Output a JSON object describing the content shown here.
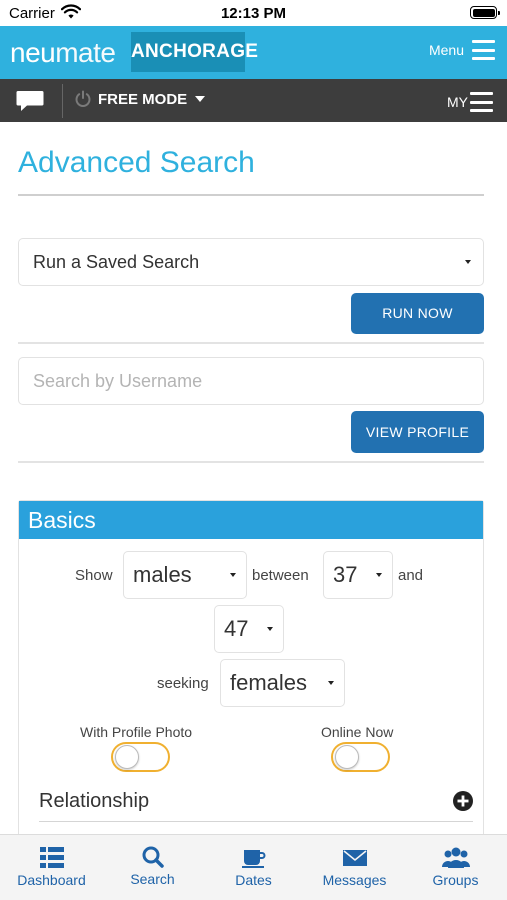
{
  "status_bar": {
    "carrier": "Carrier",
    "time": "12:13 PM"
  },
  "header": {
    "logo_left": "neu",
    "logo_right": "mate",
    "city": "ANCHORAGE",
    "menu_label": "Menu",
    "brand_color": "#2fb1de"
  },
  "subnav": {
    "mode_label": "FREE MODE",
    "my_label": "MY"
  },
  "page": {
    "title": "Advanced Search",
    "saved_search": {
      "selected": "Run a Saved Search"
    },
    "run_button": "RUN NOW",
    "username": {
      "placeholder": "Search by Username",
      "value": ""
    },
    "view_button": "VIEW PROFILE"
  },
  "basics": {
    "header": "Basics",
    "show_label": "Show",
    "gender": "males",
    "between_label": "between",
    "age_min": "37",
    "and_label": "and",
    "age_max": "47",
    "seeking_label": "seeking",
    "seeking": "females",
    "with_photo_label": "With Profile Photo",
    "with_photo_on": false,
    "online_now_label": "Online Now",
    "online_now_on": false,
    "relationship_label": "Relationship"
  },
  "tabs": [
    {
      "label": "Dashboard",
      "icon": "dashboard-icon"
    },
    {
      "label": "Search",
      "icon": "search-icon"
    },
    {
      "label": "Dates",
      "icon": "coffee-icon"
    },
    {
      "label": "Messages",
      "icon": "envelope-icon"
    },
    {
      "label": "Groups",
      "icon": "groups-icon"
    }
  ],
  "colors": {
    "accent": "#2fb1de",
    "button": "#2271b1",
    "panel_header": "#2aa1dc",
    "toggle_border": "#f0b030",
    "tab_icon": "#1f63a8"
  }
}
